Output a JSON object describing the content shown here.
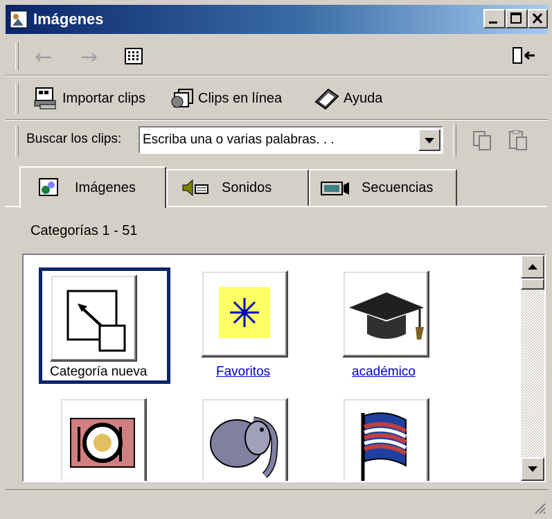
{
  "window": {
    "title": "Imágenes"
  },
  "nav": {
    "back_label": "←",
    "forward_label": "→"
  },
  "toolbar": {
    "import_label": "Importar clips",
    "online_label": "Clips en línea",
    "help_label": "Ayuda"
  },
  "search": {
    "label": "Buscar los clips:",
    "placeholder": "Escriba una o varias palabras. . ."
  },
  "tabs": [
    {
      "label": "Imágenes",
      "active": true
    },
    {
      "label": "Sonidos",
      "active": false
    },
    {
      "label": "Secuencias",
      "active": false
    }
  ],
  "categories": {
    "count_label": "Categorías 1 - 51",
    "items": [
      {
        "label": "Categoría nueva",
        "icon": "new-category-icon",
        "selected": true
      },
      {
        "label": "Favoritos",
        "icon": "favorites-star-icon"
      },
      {
        "label": "académico",
        "icon": "graduation-cap-icon"
      },
      {
        "label": "",
        "icon": "dining-plate-icon"
      },
      {
        "label": "",
        "icon": "elephant-icon"
      },
      {
        "label": "",
        "icon": "flag-icon"
      }
    ]
  },
  "colors": {
    "titlebar": "#0a246a",
    "link": "#0000cc",
    "selection": "#0a246a"
  }
}
